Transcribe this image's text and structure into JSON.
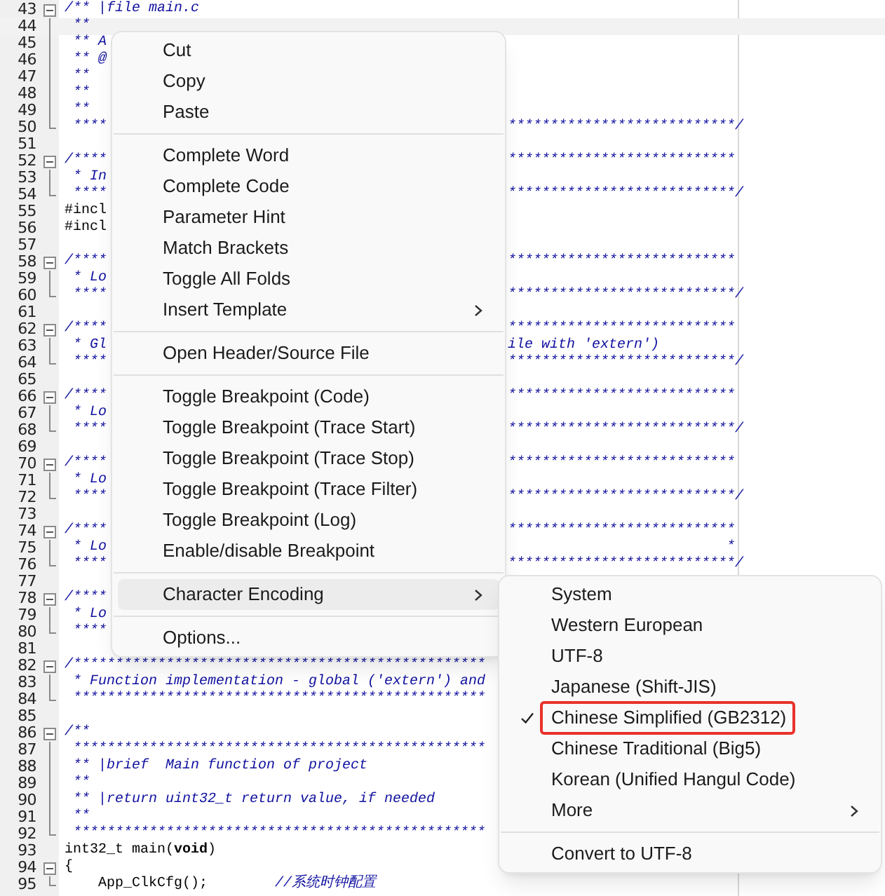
{
  "editor": {
    "lines": [
      {
        "number": "43",
        "comment": "/** |file main.c",
        "expanded": true,
        "children": [
          {
            "number": "44",
            "comment": " **",
            "current": true
          },
          {
            "number": "45",
            "comment": " ** A"
          },
          {
            "number": "46",
            "comment": " ** @"
          },
          {
            "number": "47",
            "comment": " **"
          },
          {
            "number": "48",
            "comment": " **"
          },
          {
            "number": "49",
            "comment": " **"
          },
          {
            "number": "50",
            "comment": " ****",
            "tail": "***************************/"
          }
        ]
      },
      {
        "number": "51"
      },
      {
        "number": "52",
        "comment": "/****",
        "tail": "***************************",
        "expanded": true,
        "children": [
          {
            "number": "53",
            "comment": " * In"
          },
          {
            "number": "54",
            "comment": " ****",
            "tail": "***************************/"
          }
        ]
      },
      {
        "number": "55",
        "code": "#incl"
      },
      {
        "number": "56",
        "code": "#incl"
      },
      {
        "number": "57"
      },
      {
        "number": "58",
        "comment": "/****",
        "tail": "***************************",
        "expanded": true,
        "children": [
          {
            "number": "59",
            "comment": " * Lo"
          },
          {
            "number": "60",
            "comment": " ****",
            "tail": "***************************/"
          }
        ]
      },
      {
        "number": "61"
      },
      {
        "number": "62",
        "comment": "/****",
        "tail": "***************************",
        "expanded": true,
        "children": [
          {
            "number": "63",
            "comment": " * Gl",
            "tail": "ile with 'extern')"
          },
          {
            "number": "64",
            "comment": " ****",
            "tail": "***************************/"
          }
        ]
      },
      {
        "number": "65"
      },
      {
        "number": "66",
        "comment": "/****",
        "tail": "***************************",
        "expanded": true,
        "children": [
          {
            "number": "67",
            "comment": " * Lo"
          },
          {
            "number": "68",
            "comment": " ****",
            "tail": "***************************/"
          }
        ]
      },
      {
        "number": "69"
      },
      {
        "number": "70",
        "comment": "/****",
        "tail": "***************************",
        "expanded": true,
        "children": [
          {
            "number": "71",
            "comment": " * Lo"
          },
          {
            "number": "72",
            "comment": " ****",
            "tail": "***************************/"
          }
        ]
      },
      {
        "number": "73"
      },
      {
        "number": "74",
        "comment": "/****",
        "tail": "***************************",
        "expanded": true,
        "children": [
          {
            "number": "75",
            "comment": " * Lo",
            "tail": "                          *"
          },
          {
            "number": "76",
            "comment": " ****",
            "tail": "***************************/"
          }
        ]
      },
      {
        "number": "77"
      },
      {
        "number": "78",
        "comment": "/****",
        "expanded": true,
        "children": [
          {
            "number": "79",
            "comment": " * Lo"
          },
          {
            "number": "80",
            "comment": " ****"
          }
        ]
      },
      {
        "number": "81"
      },
      {
        "number": "82",
        "comment": "/*************************************************",
        "expanded": true,
        "children": [
          {
            "number": "83",
            "comment": " * Function implementation - global ('extern') and"
          },
          {
            "number": "84",
            "comment": " *************************************************"
          }
        ]
      },
      {
        "number": "85"
      },
      {
        "number": "86",
        "comment": "/**",
        "expanded": true,
        "children": [
          {
            "number": "87",
            "comment": " *************************************************"
          },
          {
            "number": "88",
            "comment": " ** |brief  Main function of project"
          },
          {
            "number": "89",
            "comment": " **"
          },
          {
            "number": "90",
            "comment": " ** |return uint32_t return value, if needed"
          },
          {
            "number": "91",
            "comment": " **"
          },
          {
            "number": "92",
            "comment": " *************************************************"
          }
        ]
      },
      {
        "number": "93",
        "code": "int32_t main(**void**)"
      },
      {
        "number": "94",
        "code": "{",
        "expanded": true,
        "children": [
          {
            "number": "95",
            "code": "    App_ClkCfg();",
            "comment": "        //系统时钟配置"
          }
        ]
      }
    ]
  },
  "context_menu": {
    "items": [
      {
        "kind": "item",
        "label": "Cut",
        "selected": false
      },
      {
        "kind": "item",
        "label": "Copy",
        "selected": false
      },
      {
        "kind": "item",
        "label": "Paste",
        "selected": false
      },
      {
        "kind": "separator"
      },
      {
        "kind": "item",
        "label": "Complete Word",
        "selected": false
      },
      {
        "kind": "item",
        "label": "Complete Code",
        "selected": false
      },
      {
        "kind": "item",
        "label": "Parameter Hint",
        "selected": false
      },
      {
        "kind": "item",
        "label": "Match Brackets",
        "selected": false
      },
      {
        "kind": "item",
        "label": "Toggle All Folds",
        "selected": false
      },
      {
        "kind": "item",
        "label": "Insert Template",
        "selected": false,
        "submenu": true
      },
      {
        "kind": "separator"
      },
      {
        "kind": "item",
        "label": "Open Header/Source File",
        "selected": false
      },
      {
        "kind": "separator"
      },
      {
        "kind": "item",
        "label": "Toggle Breakpoint (Code)",
        "selected": false
      },
      {
        "kind": "item",
        "label": "Toggle Breakpoint (Trace Start)",
        "selected": false
      },
      {
        "kind": "item",
        "label": "Toggle Breakpoint (Trace Stop)",
        "selected": false
      },
      {
        "kind": "item",
        "label": "Toggle Breakpoint (Trace Filter)",
        "selected": false
      },
      {
        "kind": "item",
        "label": "Toggle Breakpoint (Log)",
        "selected": false
      },
      {
        "kind": "item",
        "label": "Enable/disable Breakpoint",
        "selected": false
      },
      {
        "kind": "separator"
      },
      {
        "kind": "item",
        "label": "Character Encoding",
        "selected": true,
        "submenu": true
      },
      {
        "kind": "separator"
      },
      {
        "kind": "item",
        "label": "Options...",
        "selected": false
      }
    ]
  },
  "encoding_submenu": {
    "items": [
      {
        "kind": "item",
        "label": "System",
        "checked": false
      },
      {
        "kind": "item",
        "label": "Western European",
        "checked": false
      },
      {
        "kind": "item",
        "label": "UTF-8",
        "checked": false
      },
      {
        "kind": "item",
        "label": "Japanese (Shift-JIS)",
        "checked": false
      },
      {
        "kind": "item",
        "label": "Chinese Simplified (GB2312)",
        "checked": true,
        "annotated": true
      },
      {
        "kind": "item",
        "label": "Chinese Traditional (Big5)",
        "checked": false
      },
      {
        "kind": "item",
        "label": "Korean (Unified Hangul Code)",
        "checked": false
      },
      {
        "kind": "item",
        "label": "More",
        "checked": false,
        "submenu": true
      },
      {
        "kind": "separator"
      },
      {
        "kind": "item",
        "label": "Convert to UTF-8",
        "checked": false
      }
    ]
  }
}
